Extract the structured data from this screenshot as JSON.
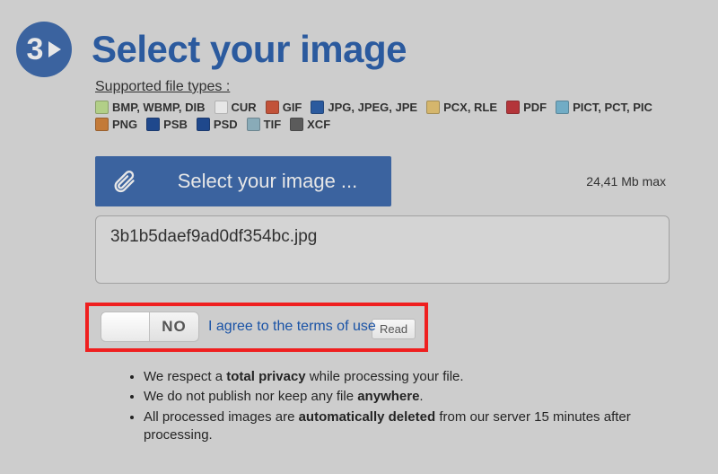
{
  "step": {
    "number": "3"
  },
  "title": "Select your image",
  "supported_label": "Supported file types :",
  "filetypes": [
    {
      "label": "BMP, WBMP, DIB",
      "icon_bg": "#bfe28a"
    },
    {
      "label": "CUR",
      "icon_bg": "#ffffff"
    },
    {
      "label": "GIF",
      "icon_bg": "#d24a2b"
    },
    {
      "label": "JPG, JPEG, JPE",
      "icon_bg": "#1a53a6"
    },
    {
      "label": "PCX, RLE",
      "icon_bg": "#e9c46a"
    },
    {
      "label": "PDF",
      "icon_bg": "#c1272d"
    },
    {
      "label": "PICT, PCT, PIC",
      "icon_bg": "#6fb7d6"
    },
    {
      "label": "PNG",
      "icon_bg": "#d47a2a"
    },
    {
      "label": "PSB",
      "icon_bg": "#0b3d91"
    },
    {
      "label": "PSD",
      "icon_bg": "#0b3d91"
    },
    {
      "label": "TIF",
      "icon_bg": "#8db6c6"
    },
    {
      "label": "XCF",
      "icon_bg": "#555555"
    }
  ],
  "select_button": "Select your image ...",
  "max_size": "24,41 Mb max",
  "filename": "3b1b5daef9ad0df354bc.jpg",
  "toggle_state": "NO",
  "terms_text": "I agree to the terms of use",
  "read_button": "Read",
  "privacy": {
    "line1_pre": "We respect a ",
    "line1_bold": "total privacy",
    "line1_post": " while processing your file.",
    "line2_pre": "We do not publish nor keep any file ",
    "line2_bold": "anywhere",
    "line2_post": ".",
    "line3_pre": "All processed images are ",
    "line3_bold": "automatically deleted",
    "line3_post": " from our server 15 minutes after processing."
  }
}
